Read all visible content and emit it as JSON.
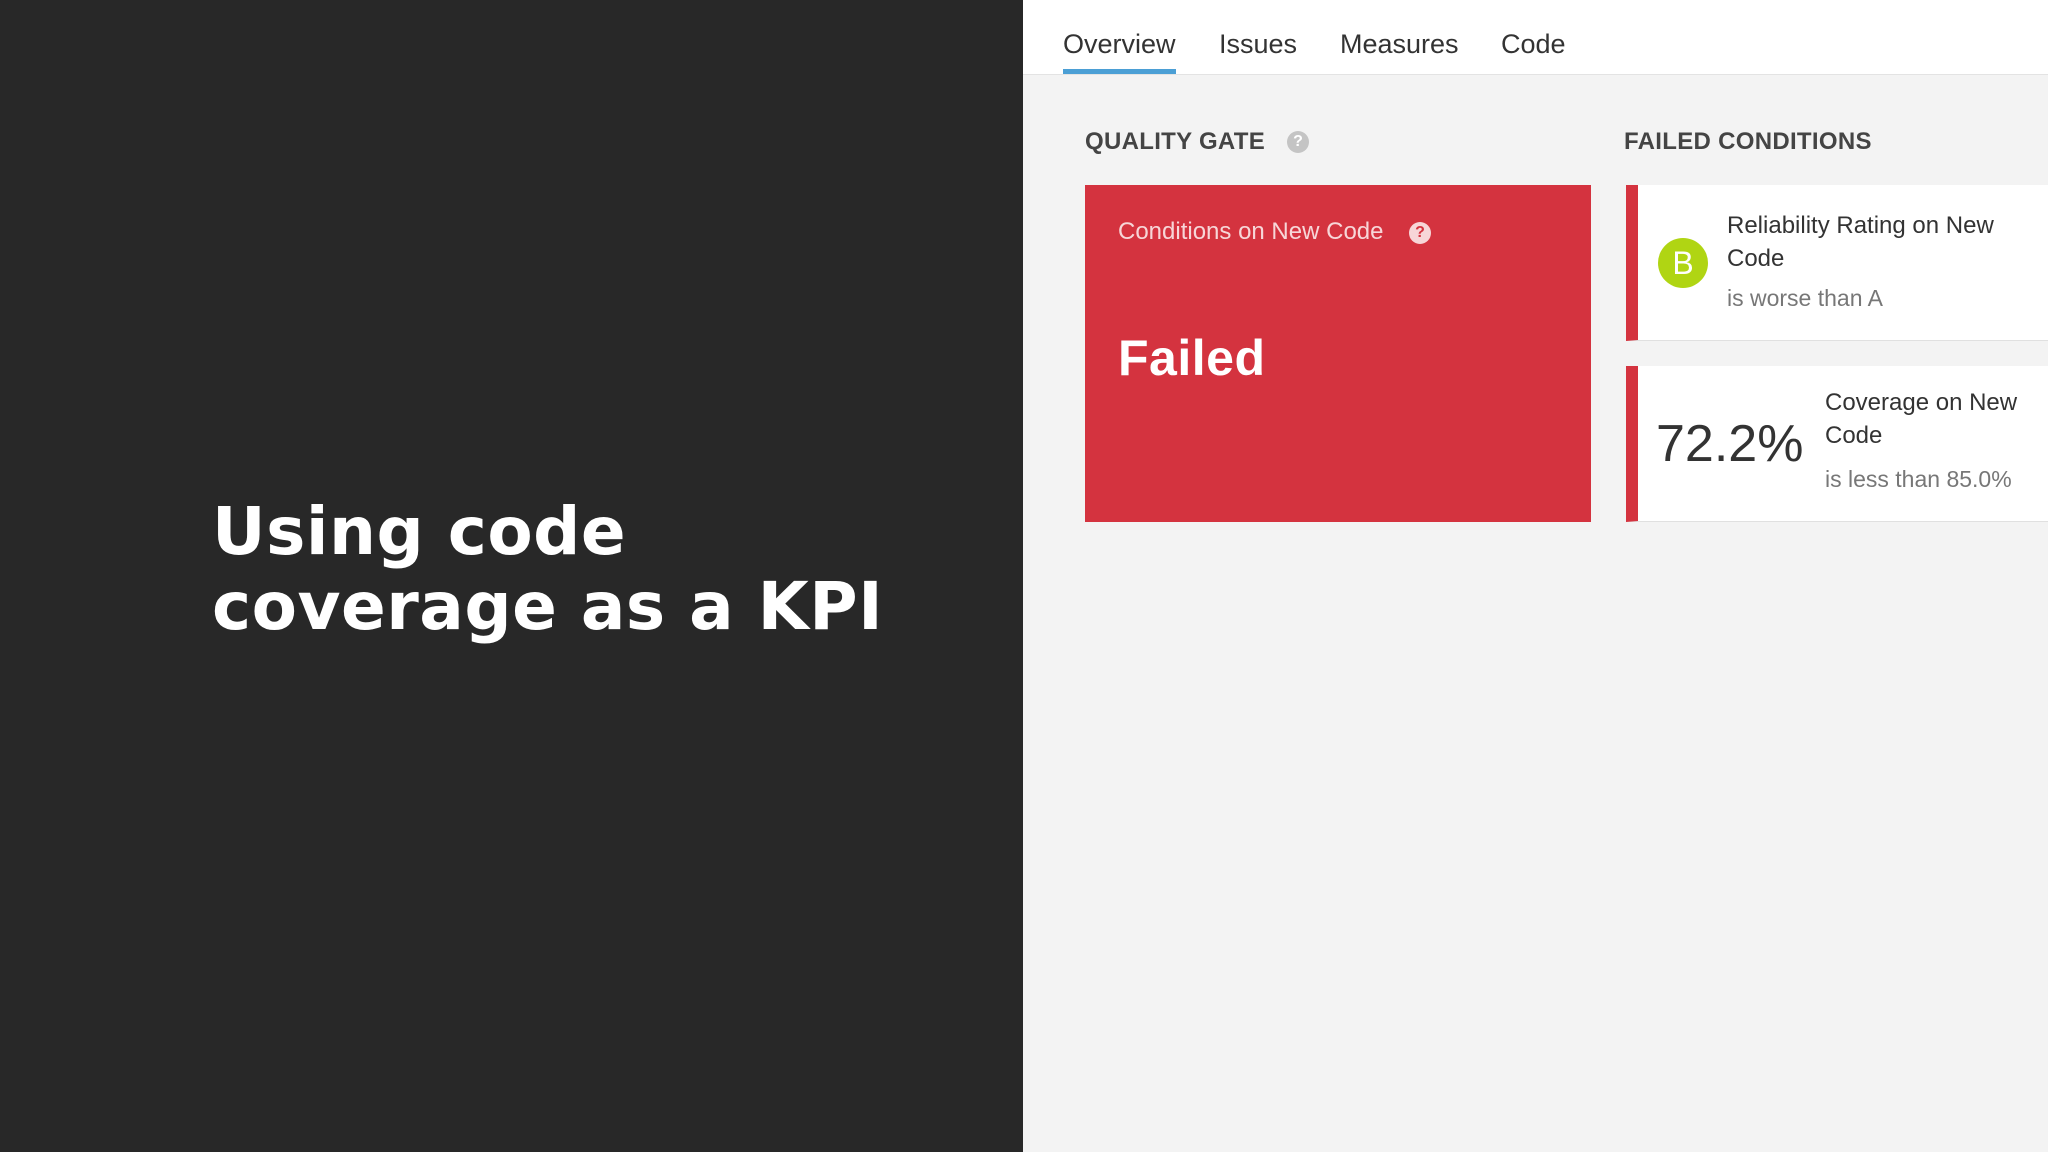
{
  "slide": {
    "title": "Using code\ncoverage as a KPI"
  },
  "tabs": {
    "overview": "Overview",
    "issues": "Issues",
    "measures": "Measures",
    "code": "Code"
  },
  "quality_gate": {
    "heading": "QUALITY GATE",
    "help_glyph": "?",
    "label": "Conditions on New Code",
    "status": "Failed",
    "status_color": "#d4333f"
  },
  "failed_conditions": {
    "heading": "FAILED CONDITIONS",
    "items": [
      {
        "badge": "B",
        "badge_color": "#b0d513",
        "metric": "Reliability Rating on New Code",
        "threshold": "is worse than A"
      },
      {
        "value": "72.2%",
        "metric": "Coverage on New Code",
        "threshold": "is less than 85.0%"
      }
    ]
  },
  "colors": {
    "slide_background": "#282828",
    "accent_tab": "#4b9fd5"
  }
}
